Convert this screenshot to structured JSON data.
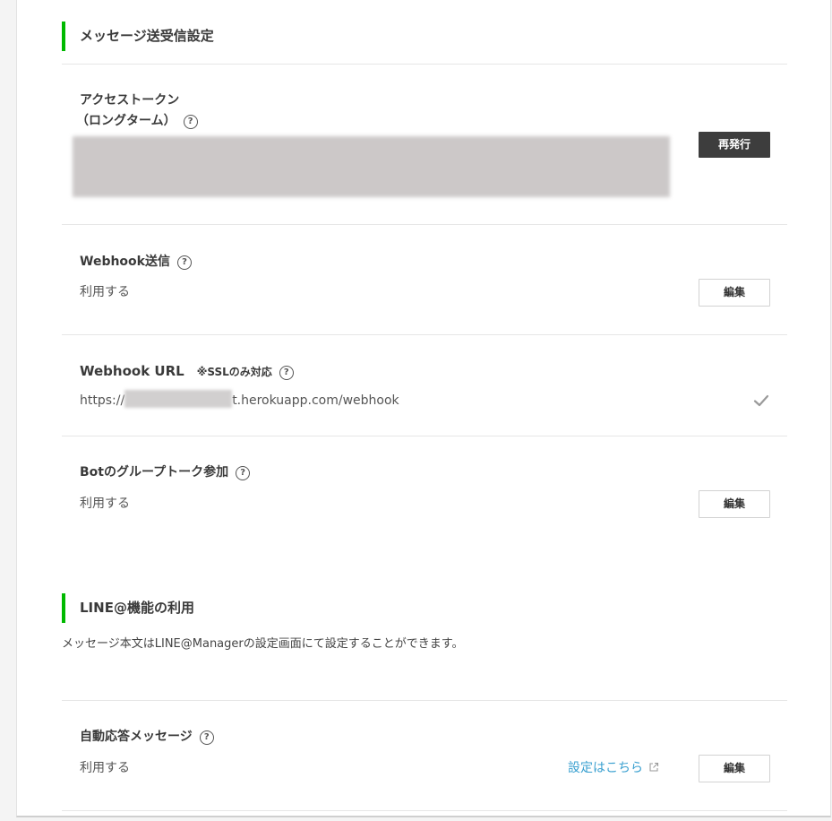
{
  "messaging": {
    "heading": "メッセージ送受信設定",
    "access_token": {
      "label_line1": "アクセストークン",
      "label_line2": "（ロングターム）",
      "reissue_label": "再発行"
    },
    "webhook_send": {
      "label": "Webhook送信",
      "value": "利用する",
      "edit_label": "編集"
    },
    "webhook_url": {
      "label": "Webhook URL",
      "note": "※SSLのみ対応",
      "url_prefix": "https://",
      "url_suffix": "t.herokuapp.com/webhook"
    },
    "group_talk": {
      "label": "Botのグループトーク参加",
      "value": "利用する",
      "edit_label": "編集"
    }
  },
  "line_at": {
    "heading": "LINE@機能の利用",
    "description": "メッセージ本文はLINE@Managerの設定画面にて設定することができます。",
    "auto_reply": {
      "label": "自動応答メッセージ",
      "value": "利用する",
      "link_label": "設定はこちら",
      "edit_label": "編集"
    }
  },
  "help_glyph": "?",
  "colors": {
    "accent": "#00b900",
    "link": "#3aa0d0",
    "dark_button": "#3d3d3d"
  }
}
